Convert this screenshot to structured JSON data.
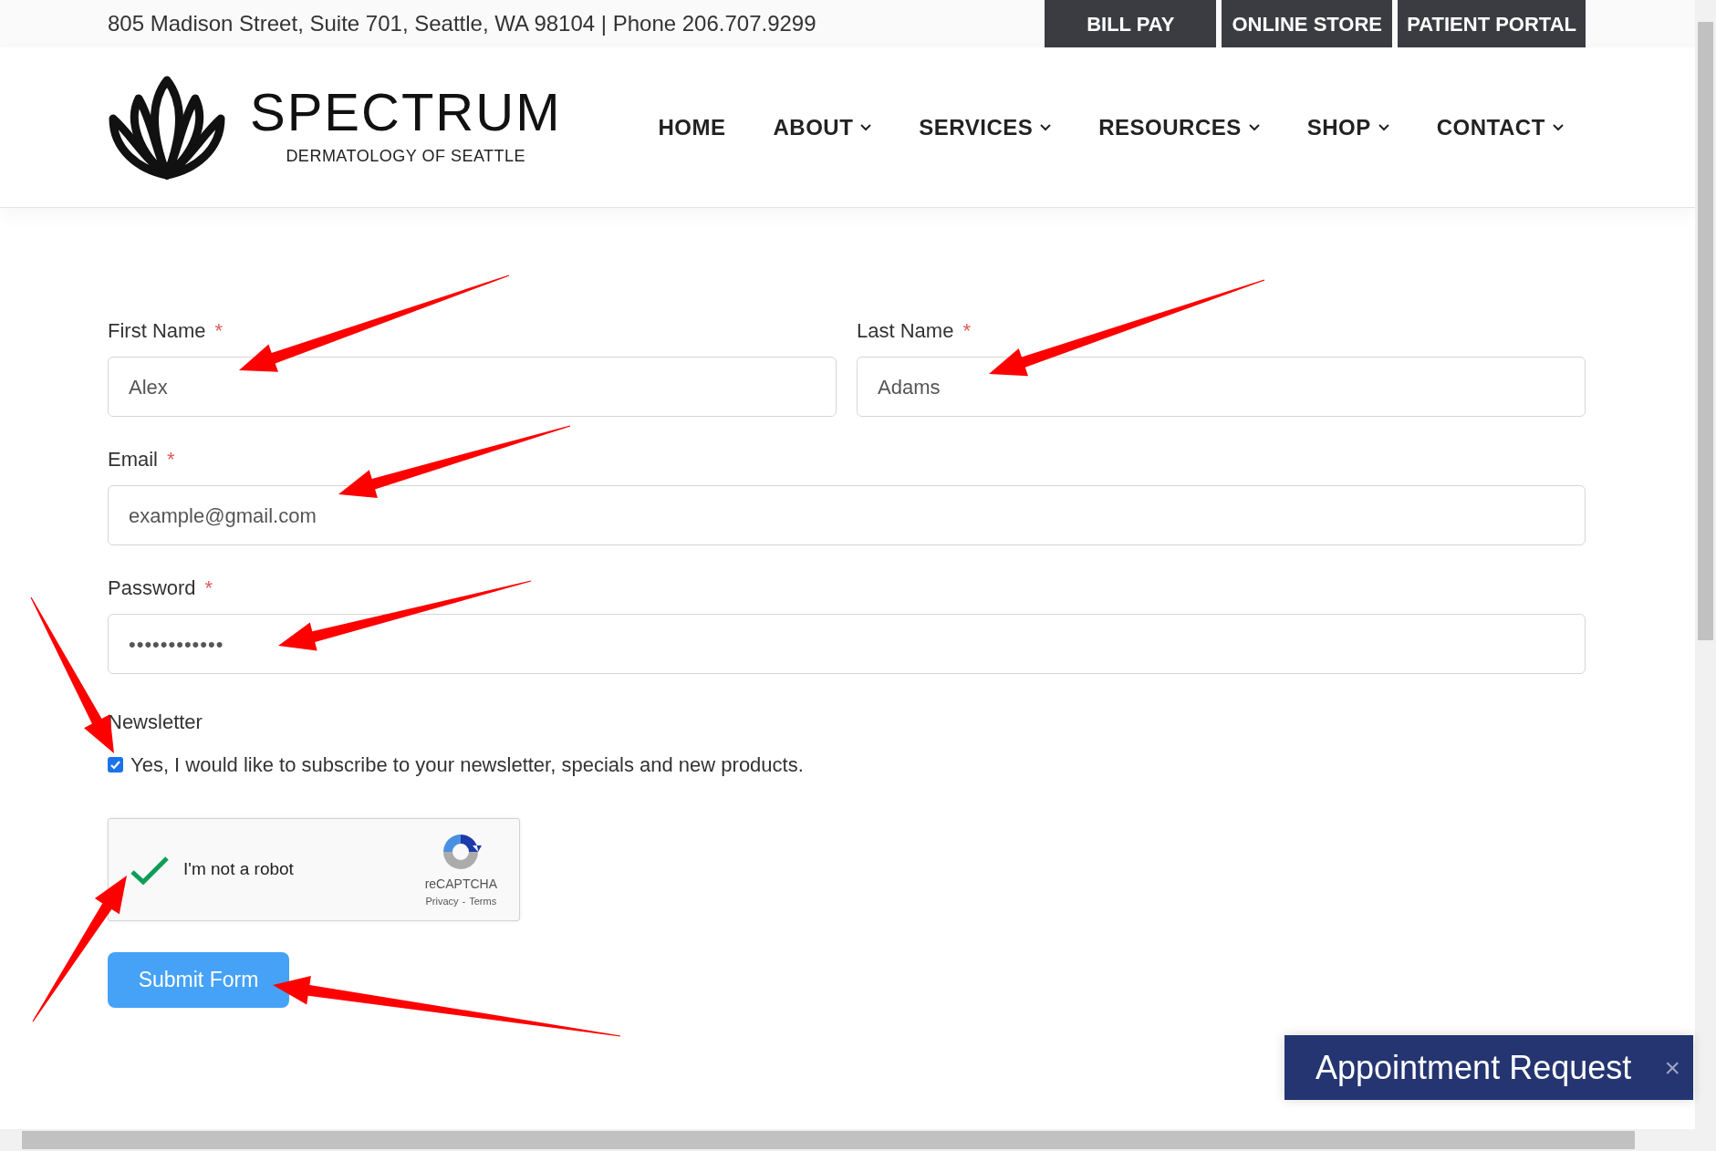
{
  "top_bar": {
    "address": "805 Madison Street, Suite 701, Seattle, WA 98104 | Phone 206.707.9299",
    "buttons": [
      "BILL PAY",
      "ONLINE STORE",
      "PATIENT PORTAL"
    ]
  },
  "logo": {
    "name": "SPECTRUM",
    "tagline": "DERMATOLOGY OF SEATTLE"
  },
  "nav": [
    {
      "label": "HOME",
      "has_menu": false
    },
    {
      "label": "ABOUT",
      "has_menu": true
    },
    {
      "label": "SERVICES",
      "has_menu": true
    },
    {
      "label": "RESOURCES",
      "has_menu": true
    },
    {
      "label": "SHOP",
      "has_menu": true
    },
    {
      "label": "CONTACT",
      "has_menu": true
    }
  ],
  "form": {
    "fields": [
      {
        "label": "First Name",
        "required": "*",
        "value": "Alex"
      },
      {
        "label": "Last Name",
        "required": "*",
        "value": "Adams"
      },
      {
        "label": "Email",
        "required": "*",
        "value": "example@gmail.com"
      },
      {
        "label": "Password",
        "required": "*",
        "value": "••••••••••••"
      }
    ],
    "newsletter": {
      "label": "Newsletter",
      "option": "Yes, I would like to subscribe to your newsletter, specials and new products.",
      "checked": true
    },
    "captcha": {
      "label": "I'm not a robot",
      "checked": true,
      "brand": "reCAPTCHA",
      "privacy": "Privacy",
      "separator": "-",
      "terms": "Terms"
    },
    "submit": "Submit Form"
  },
  "appointment": {
    "label": "Appointment Request",
    "close": "×"
  }
}
